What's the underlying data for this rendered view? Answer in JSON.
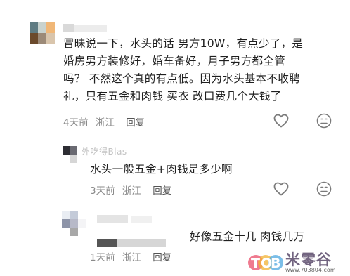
{
  "comments": [
    {
      "text_lines": [
        "冒昧说一下，水头的话 男方10W，有点少了，是",
        "婚房男方装修好，婚车备好，月子男方都全管",
        "吗？ 不然这个真的有点低。因为水头基本不收聘",
        "礼，只有五金和肉钱 买衣 改口费几个大钱了"
      ],
      "time": "4天前",
      "location": "浙江",
      "reply_label": "回复",
      "like_icon": "heart-icon",
      "dislike_icon": "unhappy-face-icon"
    }
  ],
  "replies": [
    {
      "faded_name": "外吃得Blas",
      "text": "水头一般五金+肉钱是多少啊",
      "time": "3天前",
      "location": "浙江",
      "reply_label": "回复"
    },
    {
      "text": "好像五金十几 肉钱几万",
      "time": "1天前",
      "location": "浙江",
      "reply_label": "回复"
    }
  ],
  "watermark": {
    "brand": "米零谷",
    "url": "www.703804.com"
  }
}
